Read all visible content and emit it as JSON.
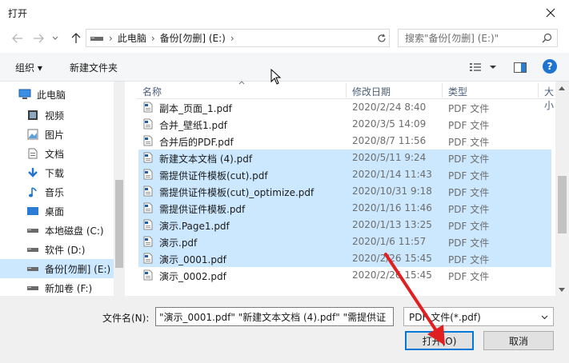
{
  "window": {
    "title": "打开",
    "close_icon": "close-icon"
  },
  "nav": {
    "back_icon": "arrow-left-icon",
    "forward_icon": "arrow-right-icon",
    "recent_icon": "chevron-down-icon",
    "up_icon": "arrow-up-icon"
  },
  "address": {
    "crumbs": [
      "此电脑",
      "备份[勿删] (E:)"
    ]
  },
  "search": {
    "placeholder": "搜索\"备份[勿删] (E:)\""
  },
  "toolbar": {
    "organize_label": "组织 ▾",
    "new_folder_label": "新建文件夹"
  },
  "sidebar": {
    "items": [
      {
        "label": "此电脑",
        "icon": "computer-icon"
      },
      {
        "label": "视频",
        "icon": "video-icon"
      },
      {
        "label": "图片",
        "icon": "pictures-icon"
      },
      {
        "label": "文档",
        "icon": "documents-icon"
      },
      {
        "label": "下载",
        "icon": "download-icon"
      },
      {
        "label": "音乐",
        "icon": "music-icon"
      },
      {
        "label": "桌面",
        "icon": "desktop-icon"
      },
      {
        "label": "本地磁盘 (C:)",
        "icon": "drive-icon"
      },
      {
        "label": "软件 (D:)",
        "icon": "drive-icon"
      },
      {
        "label": "备份[勿删] (E:)",
        "icon": "drive-icon"
      },
      {
        "label": "新加卷 (F:)",
        "icon": "drive-icon"
      }
    ],
    "selected_index": 9
  },
  "columns": {
    "name": "名称",
    "date": "修改日期",
    "type": "类型",
    "size": "大小"
  },
  "files": [
    {
      "name": "副本_页面_1.pdf",
      "date": "2020/2/24 8:40",
      "type": "PDF 文件",
      "selected": false
    },
    {
      "name": "合并_壁纸1.pdf",
      "date": "2020/3/5 14:09",
      "type": "PDF 文件",
      "selected": false
    },
    {
      "name": "合并后的PDF.pdf",
      "date": "2020/8/7 11:56",
      "type": "PDF 文件",
      "selected": false
    },
    {
      "name": "新建文本文档 (4).pdf",
      "date": "2020/5/11 9:24",
      "type": "PDF 文件",
      "selected": true
    },
    {
      "name": "需提供证件模板(cut).pdf",
      "date": "2020/1/14 11:43",
      "type": "PDF 文件",
      "selected": true
    },
    {
      "name": "需提供证件模板(cut)_optimize.pdf",
      "date": "2020/10/31 9:18",
      "type": "PDF 文件",
      "selected": true
    },
    {
      "name": "需提供证件模板.pdf",
      "date": "2020/1/16 11:46",
      "type": "PDF 文件",
      "selected": true
    },
    {
      "name": "演示.Page1.pdf",
      "date": "2020/1/13 13:25",
      "type": "PDF 文件",
      "selected": true
    },
    {
      "name": "演示.pdf",
      "date": "2020/1/6 11:57",
      "type": "PDF 文件",
      "selected": true
    },
    {
      "name": "演示_0001.pdf",
      "date": "2020/2/26 15:45",
      "type": "PDF 文件",
      "selected": true
    },
    {
      "name": "演示_0002.pdf",
      "date": "2020/2/26 15:45",
      "type": "PDF 文件",
      "selected": false
    }
  ],
  "footer": {
    "filename_label": "文件名(N):",
    "filename_value": "\"演示_0001.pdf\" \"新建文本文档 (4).pdf\" \"需提供证",
    "filetype_value": "PDF 文件(*.pdf)",
    "open_label": "打开(O)",
    "cancel_label": "取消"
  },
  "colors": {
    "selection": "#cce8ff",
    "accent": "#0078d7",
    "annotation": "#e02020"
  }
}
